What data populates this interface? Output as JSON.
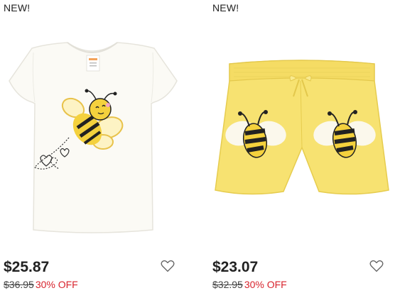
{
  "products": [
    {
      "badge": "NEW!",
      "price": "$25.87",
      "original_price": "$36.95",
      "discount": "30% OFF",
      "image_icon": "bee-tee-shirt-image",
      "wishlist_icon": "heart-outline-icon"
    },
    {
      "badge": "NEW!",
      "price": "$23.07",
      "original_price": "$32.95",
      "discount": "30% OFF",
      "image_icon": "bee-shorts-image",
      "wishlist_icon": "heart-outline-icon"
    }
  ],
  "colors": {
    "discount": "#d8242d",
    "shorts_yellow": "#f7e271",
    "bee_yellow": "#f4d13d"
  }
}
